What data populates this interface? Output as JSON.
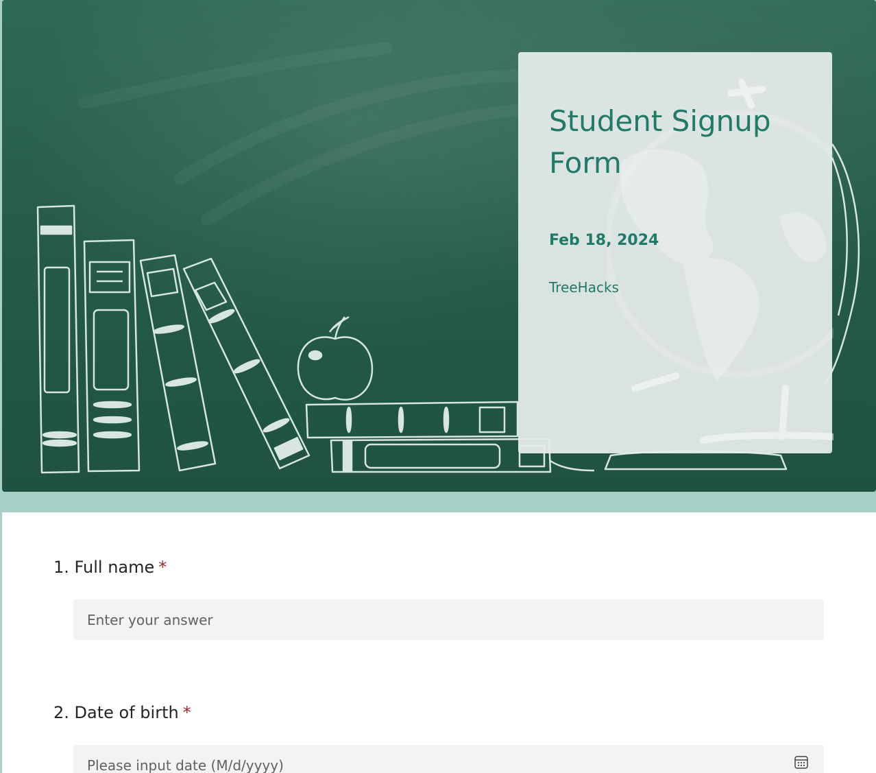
{
  "header": {
    "title": "Student Signup Form",
    "date": "Feb 18, 2024",
    "organizer": "TreeHacks"
  },
  "questions": [
    {
      "number": "1.",
      "label": "Full name",
      "required_mark": "*",
      "placeholder": "Enter your answer"
    },
    {
      "number": "2.",
      "label": "Date of birth",
      "required_mark": "*",
      "placeholder": "Please input date (M/d/yyyy)",
      "icon": "calendar-icon"
    }
  ],
  "colors": {
    "accent": "#1f7a68",
    "chalkboard": "#2a6350",
    "page_background": "#a8d0c8",
    "required": "#a4262c",
    "input_background": "#f3f3f3"
  }
}
